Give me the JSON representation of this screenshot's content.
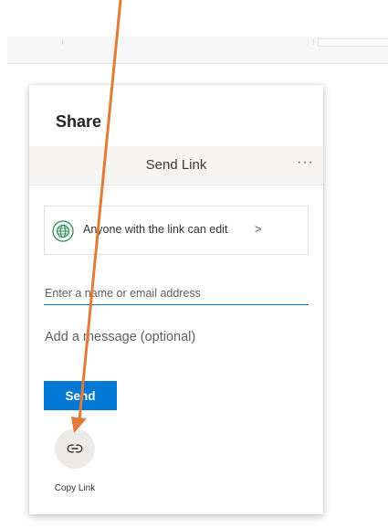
{
  "dialog": {
    "title": "Share",
    "tab_label": "Send Link",
    "more_label": "···",
    "link_settings": {
      "text": "Anyone with the link can edit",
      "chevron": ">"
    },
    "recipient": {
      "placeholder": "Enter a name or email address",
      "value": ""
    },
    "message": {
      "placeholder": "Add a message (optional)",
      "value": ""
    },
    "send_label": "Send",
    "copy_link_label": "Copy Link"
  },
  "colors": {
    "accent": "#0078d4",
    "annotation_arrow": "#e07b39",
    "globe_icon": "#2e8b57",
    "header_bg": "#f6f5f3"
  },
  "icons": {
    "link_settings": "globe-icon",
    "copy_link": "link-icon",
    "more": "more-options-icon"
  }
}
